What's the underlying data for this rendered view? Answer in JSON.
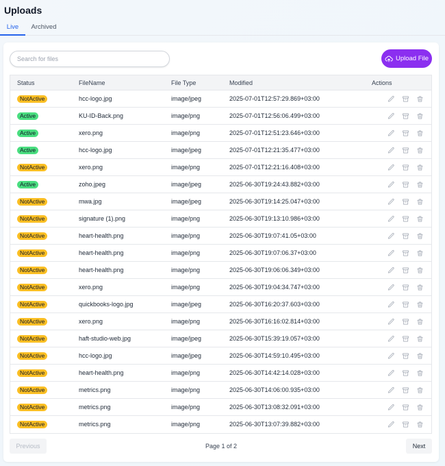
{
  "page": {
    "title": "Uploads"
  },
  "tabs": [
    {
      "label": "Live",
      "active": true
    },
    {
      "label": "Archived",
      "active": false
    }
  ],
  "search": {
    "placeholder": "Search for files",
    "value": ""
  },
  "upload_button": {
    "label": "Upload File",
    "icon": "cloud-upload-icon",
    "color": "#8b2ff0"
  },
  "table": {
    "columns": [
      "Status",
      "FileName",
      "File Type",
      "Modified",
      "Actions"
    ],
    "status_colors": {
      "NotActive": "#fbbf24",
      "Active": "#4ade80"
    },
    "action_icons": [
      "edit-icon",
      "archive-icon",
      "trash-icon"
    ],
    "rows": [
      {
        "status": "NotActive",
        "filename": "hcc-logo.jpg",
        "type": "image/jpeg",
        "modified": "2025-07-01T12:57:29.869+03:00"
      },
      {
        "status": "Active",
        "filename": "KU-ID-Back.png",
        "type": "image/png",
        "modified": "2025-07-01T12:56:06.499+03:00"
      },
      {
        "status": "Active",
        "filename": "xero.png",
        "type": "image/png",
        "modified": "2025-07-01T12:51:23.646+03:00"
      },
      {
        "status": "Active",
        "filename": "hcc-logo.jpg",
        "type": "image/jpeg",
        "modified": "2025-07-01T12:21:35.477+03:00"
      },
      {
        "status": "NotActive",
        "filename": "xero.png",
        "type": "image/png",
        "modified": "2025-07-01T12:21:16.408+03:00"
      },
      {
        "status": "Active",
        "filename": "zoho.jpeg",
        "type": "image/jpeg",
        "modified": "2025-06-30T19:24:43.882+03:00"
      },
      {
        "status": "NotActive",
        "filename": "mwa.jpg",
        "type": "image/jpeg",
        "modified": "2025-06-30T19:14:25.047+03:00"
      },
      {
        "status": "NotActive",
        "filename": "signature (1).png",
        "type": "image/png",
        "modified": "2025-06-30T19:13:10.986+03:00"
      },
      {
        "status": "NotActive",
        "filename": "heart-health.png",
        "type": "image/png",
        "modified": "2025-06-30T19:07:41.05+03:00"
      },
      {
        "status": "NotActive",
        "filename": "heart-health.png",
        "type": "image/png",
        "modified": "2025-06-30T19:07:06.37+03:00"
      },
      {
        "status": "NotActive",
        "filename": "heart-health.png",
        "type": "image/png",
        "modified": "2025-06-30T19:06:06.349+03:00"
      },
      {
        "status": "NotActive",
        "filename": "xero.png",
        "type": "image/png",
        "modified": "2025-06-30T19:04:34.747+03:00"
      },
      {
        "status": "NotActive",
        "filename": "quickbooks-logo.jpg",
        "type": "image/jpeg",
        "modified": "2025-06-30T16:20:37.603+03:00"
      },
      {
        "status": "NotActive",
        "filename": "xero.png",
        "type": "image/png",
        "modified": "2025-06-30T16:16:02.814+03:00"
      },
      {
        "status": "NotActive",
        "filename": "haft-studio-web.jpg",
        "type": "image/jpeg",
        "modified": "2025-06-30T15:39:19.057+03:00"
      },
      {
        "status": "NotActive",
        "filename": "hcc-logo.jpg",
        "type": "image/jpeg",
        "modified": "2025-06-30T14:59:10.495+03:00"
      },
      {
        "status": "NotActive",
        "filename": "heart-health.png",
        "type": "image/png",
        "modified": "2025-06-30T14:42:14.028+03:00"
      },
      {
        "status": "NotActive",
        "filename": "metrics.png",
        "type": "image/png",
        "modified": "2025-06-30T14:06:00.935+03:00"
      },
      {
        "status": "NotActive",
        "filename": "metrics.png",
        "type": "image/png",
        "modified": "2025-06-30T13:08:32.091+03:00"
      },
      {
        "status": "NotActive",
        "filename": "metrics.png",
        "type": "image/png",
        "modified": "2025-06-30T13:07:39.882+03:00"
      }
    ]
  },
  "pagination": {
    "previous_label": "Previous",
    "info": "Page 1 of 2",
    "next_label": "Next",
    "previous_disabled": true
  }
}
